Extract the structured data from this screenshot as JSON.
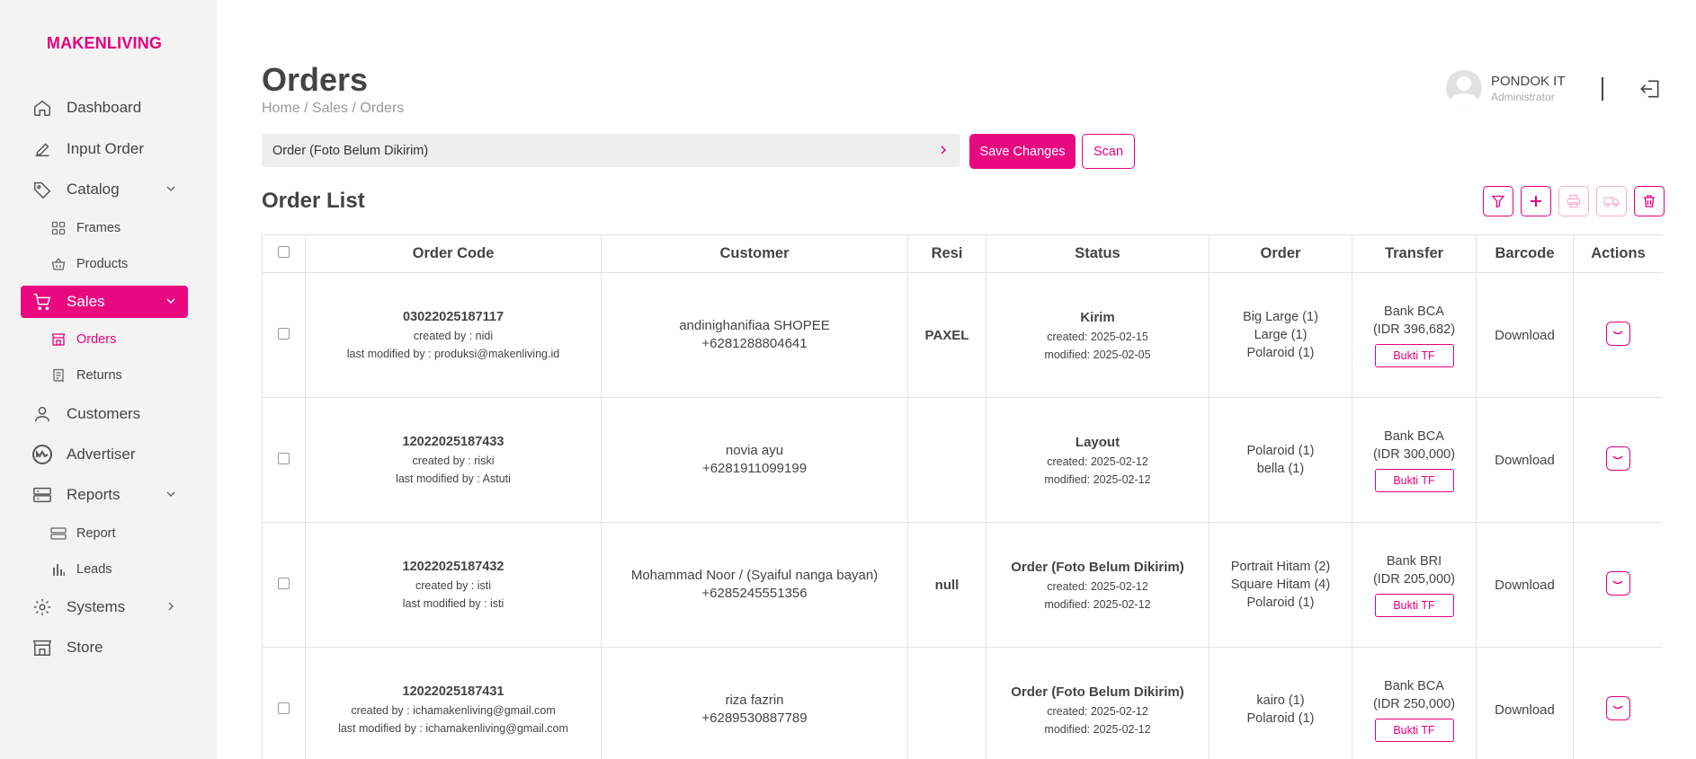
{
  "brand": "MAKENLIVING",
  "sidebar": {
    "items": [
      {
        "label": "Dashboard",
        "icon": "home-icon"
      },
      {
        "label": "Input Order",
        "icon": "pencil-icon"
      },
      {
        "label": "Catalog",
        "icon": "tag-icon"
      },
      {
        "label": "Frames",
        "icon": "grid-icon"
      },
      {
        "label": "Products",
        "icon": "basket-icon"
      },
      {
        "label": "Sales",
        "icon": "cart-icon"
      },
      {
        "label": "Orders",
        "icon": "store-icon"
      },
      {
        "label": "Returns",
        "icon": "receipt-icon"
      },
      {
        "label": "Customers",
        "icon": "user-icon"
      },
      {
        "label": "Advertiser",
        "icon": "coinmarketcap-icon"
      },
      {
        "label": "Reports",
        "icon": "server-icon"
      },
      {
        "label": "Report",
        "icon": "server-icon"
      },
      {
        "label": "Leads",
        "icon": "bar-chart-icon"
      },
      {
        "label": "Systems",
        "icon": "gear-icon"
      },
      {
        "label": "Store",
        "icon": "shop-icon"
      }
    ]
  },
  "header": {
    "title": "Orders",
    "breadcrumb": "Home / Sales / Orders",
    "user_name": "PONDOK IT",
    "user_role": "Administrator"
  },
  "toolbar": {
    "status_value": "Order (Foto Belum Dikirim)",
    "save_label": "Save Changes",
    "scan_label": "Scan"
  },
  "list_title": "Order List",
  "table": {
    "headers": [
      "Order Code",
      "Customer",
      "Resi",
      "Status",
      "Order",
      "Transfer",
      "Barcode",
      "Actions"
    ],
    "rows": [
      {
        "code": "03022025187117",
        "created": "created by : nidi",
        "modified": "last modified by : produksi@makenliving.id",
        "customer_name": "andinighanifiaa SHOPEE",
        "customer_phone": "+6281288804641",
        "resi": "PAXEL",
        "status": "Kirim",
        "status_created": "created: 2025-02-15",
        "status_modified": "modified: 2025-02-05",
        "order_lines": [
          "Big Large (1)",
          "Large (1)",
          "Polaroid (1)"
        ],
        "bank": "Bank BCA",
        "amount": "(IDR 396,682)",
        "bukti": "Bukti TF",
        "barcode": "Download"
      },
      {
        "code": "12022025187433",
        "created": "created by : riski",
        "modified": "last modified by : Astuti",
        "customer_name": "novia ayu",
        "customer_phone": "+6281911099199",
        "resi": "",
        "status": "Layout",
        "status_created": "created: 2025-02-12",
        "status_modified": "modified: 2025-02-12",
        "order_lines": [
          "Polaroid (1)",
          "bella (1)"
        ],
        "bank": "Bank BCA",
        "amount": "(IDR 300,000)",
        "bukti": "Bukti TF",
        "barcode": "Download"
      },
      {
        "code": "12022025187432",
        "created": "created by : isti",
        "modified": "last modified by : isti",
        "customer_name": "Mohammad Noor / (Syaiful nanga bayan)",
        "customer_phone": "+6285245551356",
        "resi": "null",
        "status": "Order (Foto Belum Dikirim)",
        "status_created": "created: 2025-02-12",
        "status_modified": "modified: 2025-02-12",
        "order_lines": [
          "Portrait Hitam (2)",
          "Square Hitam (4)",
          "Polaroid (1)"
        ],
        "bank": "Bank BRI",
        "amount": "(IDR 205,000)",
        "bukti": "Bukti TF",
        "barcode": "Download"
      },
      {
        "code": "12022025187431",
        "created": "created by : ichamakenliving@gmail.com",
        "modified": "last modified by : ichamakenliving@gmail.com",
        "customer_name": "riza fazrin",
        "customer_phone": "+6289530887789",
        "resi": "",
        "status": "Order (Foto Belum Dikirim)",
        "status_created": "created: 2025-02-12",
        "status_modified": "modified: 2025-02-12",
        "order_lines": [
          "kairo (1)",
          "Polaroid (1)"
        ],
        "bank": "Bank BCA",
        "amount": "(IDR 250,000)",
        "bukti": "Bukti TF",
        "barcode": "Download"
      }
    ]
  },
  "colors": {
    "accent": "#ea0880",
    "accent_light": "#f6aed2",
    "sidebar_bg": "#f3f3f3",
    "text": "#444444"
  }
}
